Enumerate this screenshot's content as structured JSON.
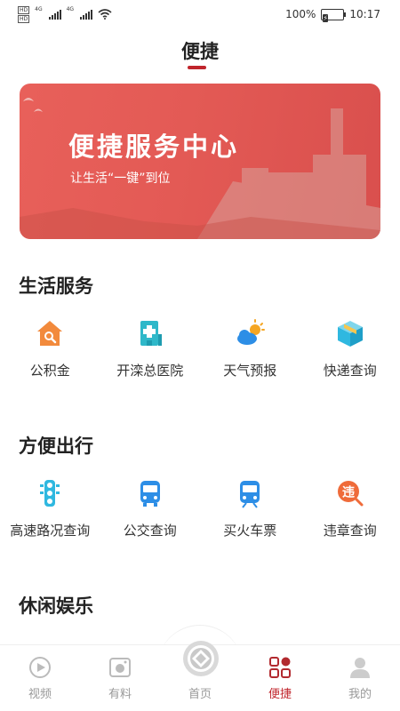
{
  "status_bar": {
    "battery": "100%",
    "time": "10:17",
    "network": "4G",
    "hd_label": "HD"
  },
  "header": {
    "title": "便捷"
  },
  "banner": {
    "title": "便捷服务中心",
    "subtitle": "让生活“一键”到位"
  },
  "sections": [
    {
      "title": "生活服务",
      "items": [
        {
          "label": "公积金",
          "icon": "house-search-icon"
        },
        {
          "label": "开滦总医院",
          "icon": "hospital-icon"
        },
        {
          "label": "天气预报",
          "icon": "weather-icon"
        },
        {
          "label": "快递查询",
          "icon": "package-icon"
        }
      ]
    },
    {
      "title": "方便出行",
      "items": [
        {
          "label": "高速路况查询",
          "icon": "traffic-light-icon"
        },
        {
          "label": "公交查询",
          "icon": "bus-icon"
        },
        {
          "label": "买火车票",
          "icon": "train-icon"
        },
        {
          "label": "违章查询",
          "icon": "violation-icon"
        }
      ]
    },
    {
      "title": "休闲娱乐",
      "items": []
    }
  ],
  "tab_bar": {
    "tabs": [
      {
        "label": "视频",
        "icon": "video-play-icon",
        "active": false
      },
      {
        "label": "有料",
        "icon": "camera-icon",
        "active": false
      },
      {
        "label": "首页",
        "icon": "home-logo-icon",
        "active": false
      },
      {
        "label": "便捷",
        "icon": "apps-grid-icon",
        "active": true
      },
      {
        "label": "我的",
        "icon": "profile-icon",
        "active": false
      }
    ]
  },
  "colors": {
    "accent": "#c0252c",
    "banner": "#e35a55",
    "orange": "#f08a3c",
    "blue": "#2fb8e0"
  }
}
